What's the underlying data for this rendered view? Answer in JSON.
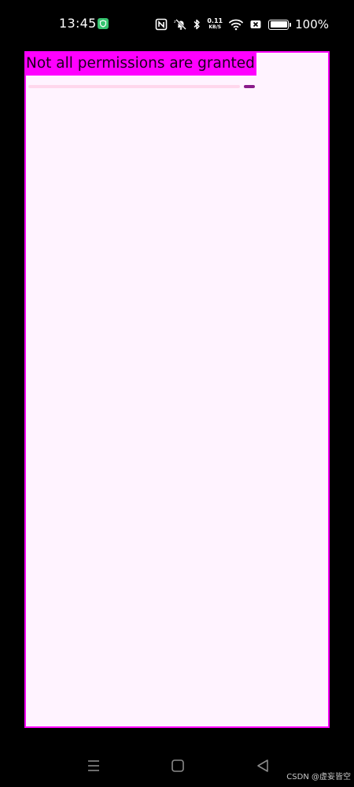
{
  "status_bar": {
    "time": "13:45",
    "net_speed_value": "0.11",
    "net_speed_unit": "KB/S",
    "battery_percent": "100%",
    "icons": [
      "shield-icon",
      "nfc-icon",
      "mute-icon",
      "bluetooth-icon",
      "wifi-icon",
      "sim-off-icon",
      "battery-icon"
    ]
  },
  "app": {
    "message": "Not all permissions are granted",
    "progress_fraction": 0.04,
    "colors": {
      "frame_border": "#ff00ff",
      "background": "#fff3ff",
      "message_background": "#ff00ff",
      "progress_track": "#ffd7ec",
      "progress_indicator": "#8b1a8b"
    }
  },
  "nav_bar": {
    "buttons": [
      "menu-icon",
      "home-icon",
      "back-icon"
    ]
  },
  "watermark": "CSDN @虚妄皆空"
}
